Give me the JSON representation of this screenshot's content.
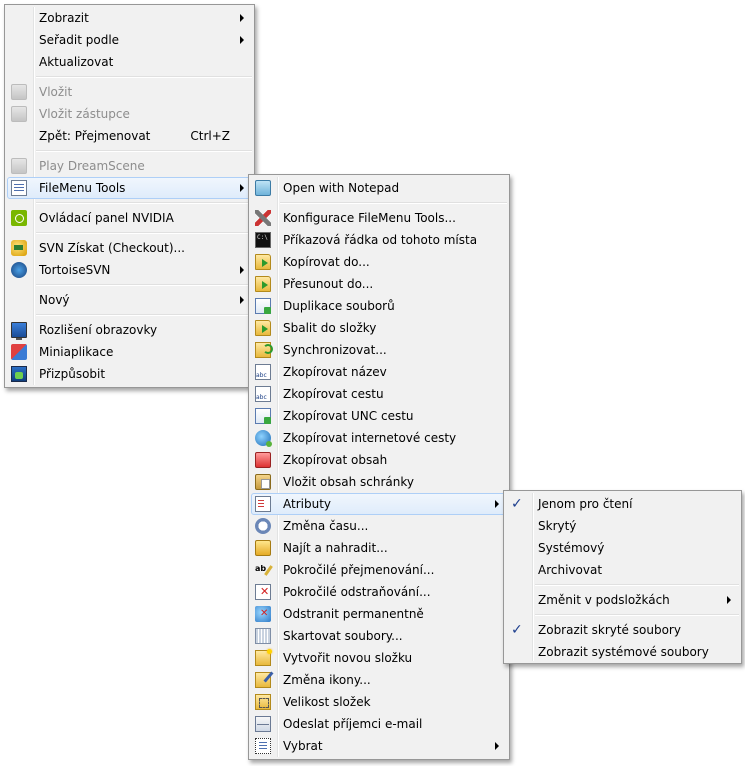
{
  "main_menu": {
    "items": [
      {
        "label": "Zobrazit",
        "submenu": true
      },
      {
        "label": "Seřadit podle",
        "submenu": true
      },
      {
        "label": "Aktualizovat"
      },
      {
        "label": "Vložit",
        "disabled": true
      },
      {
        "label": "Vložit zástupce",
        "disabled": true
      },
      {
        "label": "Zpět: Přejmenovat",
        "shortcut": "Ctrl+Z"
      },
      {
        "label": "Play DreamScene",
        "disabled": true
      },
      {
        "label": "FileMenu Tools",
        "submenu": true,
        "highlighted": true
      },
      {
        "label": "Ovládací panel NVIDIA"
      },
      {
        "label": "SVN Získat (Checkout)..."
      },
      {
        "label": "TortoiseSVN",
        "submenu": true
      },
      {
        "label": "Nový",
        "submenu": true
      },
      {
        "label": "Rozlišení obrazovky"
      },
      {
        "label": "Miniaplikace"
      },
      {
        "label": "Přizpůsobit"
      }
    ]
  },
  "filemenu_tools": {
    "items": [
      {
        "label": "Open with Notepad"
      },
      {
        "label": "Konfigurace FileMenu Tools..."
      },
      {
        "label": "Příkazová řádka od tohoto místa"
      },
      {
        "label": "Kopírovat do..."
      },
      {
        "label": "Přesunout do..."
      },
      {
        "label": "Duplikace souborů"
      },
      {
        "label": "Sbalit do složky"
      },
      {
        "label": "Synchronizovat..."
      },
      {
        "label": "Zkopírovat název"
      },
      {
        "label": "Zkopírovat cestu"
      },
      {
        "label": "Zkopírovat UNC cestu"
      },
      {
        "label": "Zkopírovat internetové cesty"
      },
      {
        "label": "Zkopírovat obsah"
      },
      {
        "label": "Vložit obsah schránky"
      },
      {
        "label": "Atributy",
        "submenu": true,
        "highlighted": true
      },
      {
        "label": "Změna času..."
      },
      {
        "label": "Najít a nahradit..."
      },
      {
        "label": "Pokročilé přejmenování..."
      },
      {
        "label": "Pokročilé odstraňování..."
      },
      {
        "label": "Odstranit permanentně"
      },
      {
        "label": "Skartovat soubory..."
      },
      {
        "label": "Vytvořit novou složku"
      },
      {
        "label": "Změna ikony..."
      },
      {
        "label": "Velikost složek"
      },
      {
        "label": "Odeslat příjemci e-mail"
      },
      {
        "label": "Vybrat",
        "submenu": true
      }
    ]
  },
  "attributes_menu": {
    "items": [
      {
        "label": "Jenom pro čtení",
        "checked": true
      },
      {
        "label": "Skrytý"
      },
      {
        "label": "Systémový"
      },
      {
        "label": "Archivovat"
      },
      {
        "label": "Změnit v podsložkách",
        "submenu": true
      },
      {
        "label": "Zobrazit skryté soubory",
        "checked": true
      },
      {
        "label": "Zobrazit systémové soubory"
      }
    ],
    "check_glyph": "✓"
  },
  "colors": {
    "menu_bg": "#f1f1f1",
    "menu_border": "#979797",
    "highlight_border": "#aecff7",
    "disabled_text": "#8d8d8d",
    "check": "#1e3f8e"
  }
}
